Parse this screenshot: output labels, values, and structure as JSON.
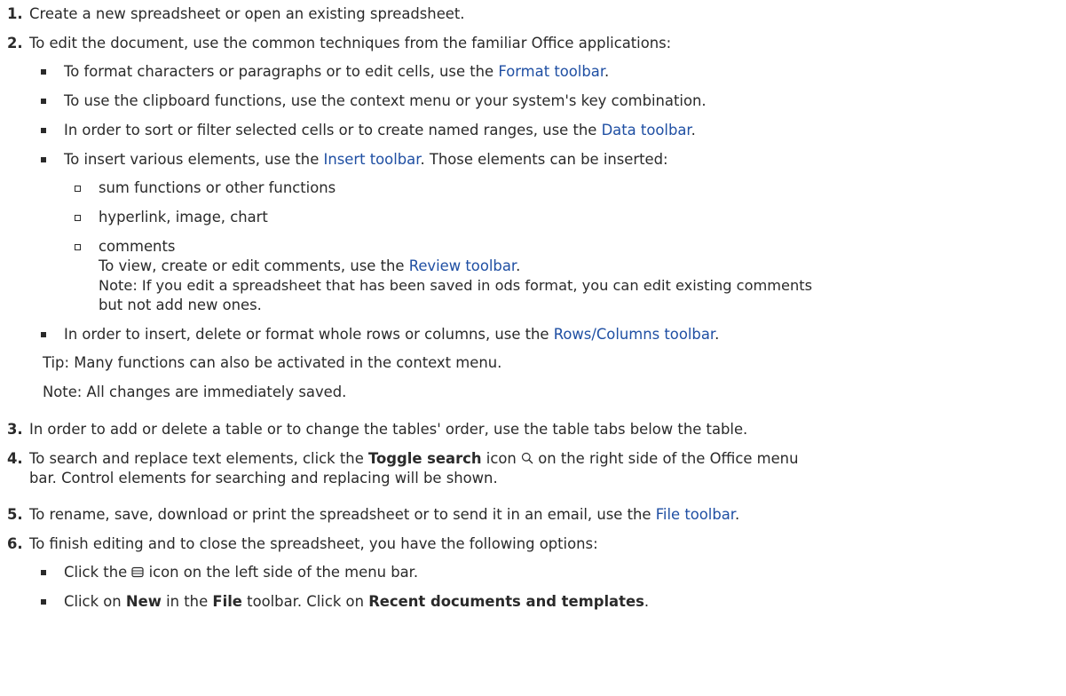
{
  "steps": [
    {
      "number": "1.",
      "text": "Create a new spreadsheet or open an existing spreadsheet."
    },
    {
      "number": "2.",
      "text": "To edit the document, use the common techniques from the familiar Office applications:",
      "items": [
        {
          "pre": "To format characters or paragraphs or to edit cells, use the ",
          "link": "Format toolbar",
          "post": "."
        },
        {
          "text": "To use the clipboard functions, use the context menu or your system's key combination."
        },
        {
          "pre": "In order to sort or filter selected cells or to create named ranges, use the ",
          "link": "Data toolbar",
          "post": "."
        },
        {
          "pre": "To insert various elements, use the ",
          "link": "Insert toolbar",
          "post": ". Those elements can be inserted:",
          "subitems": [
            {
              "text": "sum functions or other functions"
            },
            {
              "text": "hyperlink, image, chart"
            },
            {
              "text": "comments",
              "note_pre": "To view, create or edit comments, use the ",
              "note_link": "Review toolbar",
              "note_post": ".",
              "note2_line1": "Note: If you edit a spreadsheet that has been saved in ods format, you can edit existing comments",
              "note2_line2": "but not add new ones."
            }
          ]
        },
        {
          "pre": "In order to insert, delete or format whole rows or columns, use the ",
          "link": "Rows/Columns toolbar",
          "post": "."
        }
      ],
      "tip": "Tip: Many functions can also be activated in the context menu.",
      "note": "Note: All changes are immediately saved."
    },
    {
      "number": "3.",
      "text": "In order to add or delete a table or to change the tables' order, use the table tabs below the table."
    },
    {
      "number": "4.",
      "pre": "To search and replace text elements, click the ",
      "bold": "Toggle search",
      "mid": " icon",
      "post": " on the right side of the Office menu",
      "line2": "bar. Control elements for searching and replacing will be shown.",
      "icon": "search-icon"
    },
    {
      "number": "5.",
      "pre": "To rename, save, download or print the spreadsheet or to send it in an email, use the ",
      "link": "File toolbar",
      "post": "."
    },
    {
      "number": "6.",
      "text": "To finish editing and to close the spreadsheet, you have the following options:",
      "items": [
        {
          "pre": "Click the ",
          "icon": "spreadsheet-icon",
          "post": " icon on the left side of the menu bar."
        },
        {
          "pre": "Click on ",
          "b1": "New",
          "mid1": " in the ",
          "b2": "File",
          "mid2": " toolbar. Click on ",
          "b3": "Recent documents and templates",
          "post": "."
        }
      ]
    }
  ],
  "colors": {
    "text": "#2a2a2a",
    "link": "#1f4fa3"
  }
}
